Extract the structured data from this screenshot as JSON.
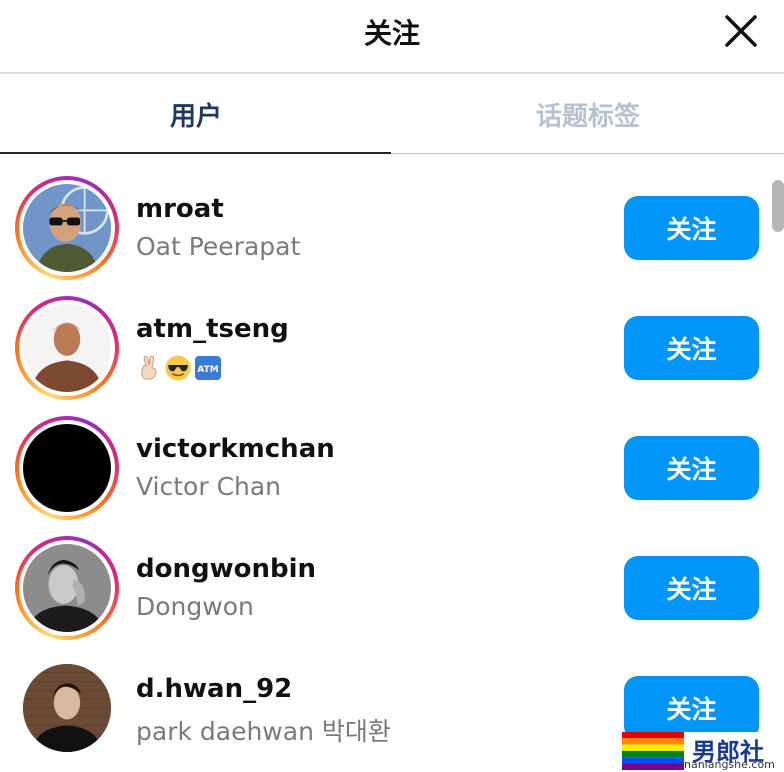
{
  "header": {
    "title": "关注",
    "close_icon": "close-icon"
  },
  "tabs": [
    {
      "label": "用户",
      "active": true
    },
    {
      "label": "话题标签",
      "active": false
    }
  ],
  "users": [
    {
      "username": "mroat",
      "fullname": "Oat Peerapat",
      "button": "关注",
      "story_ring": true
    },
    {
      "username": "atm_tseng",
      "fullname": "",
      "emojis": [
        "victory-hand",
        "sunglasses-face",
        "atm-sign"
      ],
      "button": "关注",
      "story_ring": true
    },
    {
      "username": "victorkmchan",
      "fullname": "Victor Chan",
      "button": "关注",
      "story_ring": true
    },
    {
      "username": "dongwonbin",
      "fullname": "Dongwon",
      "button": "关注",
      "story_ring": true
    },
    {
      "username": "d.hwan_92",
      "fullname": "park daehwan 박대환",
      "button": "关注",
      "story_ring": false
    }
  ],
  "colors": {
    "primary_button": "#0095f6",
    "active_tab": "#1f3a5f",
    "inactive_tab": "#b7c2cd",
    "secondary_text": "#7a7a7a"
  },
  "watermark": {
    "brand": "男郎社",
    "url": "nanlangshe.com"
  }
}
